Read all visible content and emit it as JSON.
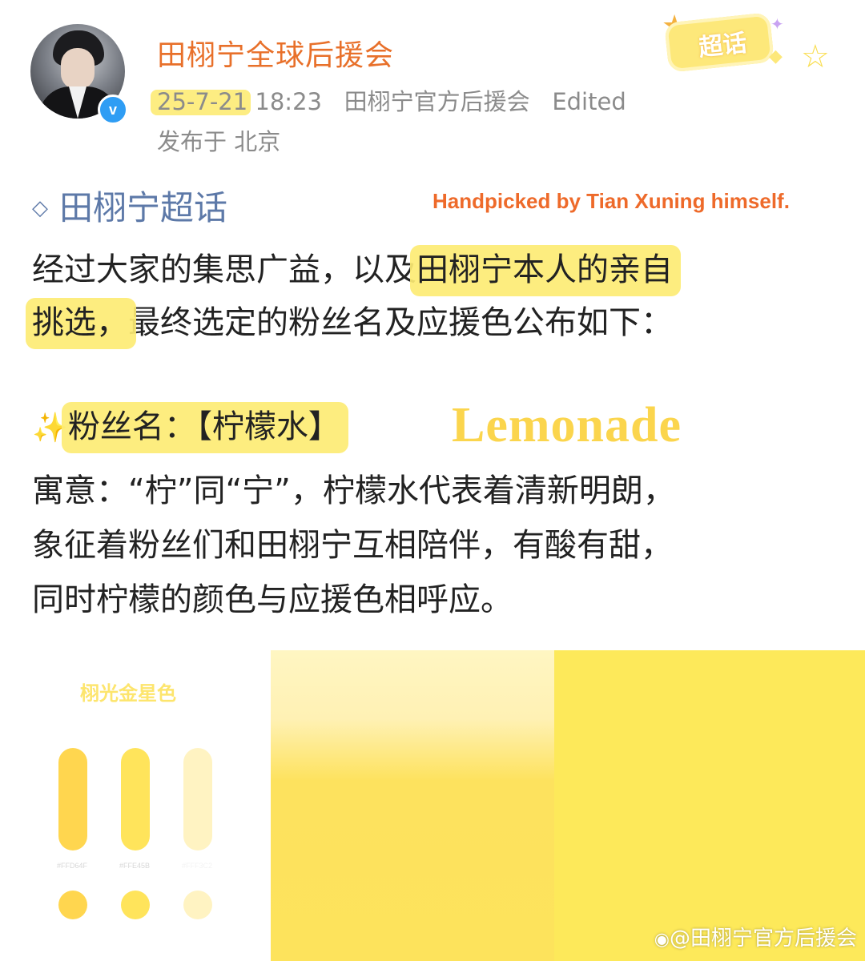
{
  "post": {
    "author": "田栩宁全球后援会",
    "date": "25-7-21",
    "time": "18:23",
    "source": "田栩宁官方后援会",
    "edited": "Edited",
    "location": "发布于 北京",
    "badge": "超话",
    "verified_glyph": "v",
    "topic": "田栩宁超话",
    "annotation": "Handpicked by Tian Xuning himself.",
    "para1": {
      "line1_before": "经过大家的集思广益，以及",
      "line1_highlight": "田栩宁本人的亲自",
      "line2_highlight": "挑选，",
      "line2_after": "最终选定的粉丝名及应援色公布如下："
    },
    "fan_name": {
      "sparkles": "✨",
      "label": "粉丝名：【柠檬水】",
      "english": "Lemonade"
    },
    "meaning_lines": [
      "寓意：“柠”同“宁”，柠檬水代表着清新明朗，",
      "象征着粉丝们和田栩宁互相陪伴，有酸有甜，",
      "同时柠檬的颜色与应援色相呼应。"
    ]
  },
  "palette": {
    "title": "栩光金星色",
    "swatches": [
      {
        "code": "#FFD64F",
        "color": "#FFD64F"
      },
      {
        "code": "#FFE45B",
        "color": "#FFE45B"
      },
      {
        "code": "#FFF3C2",
        "color": "#FFF3C2"
      }
    ]
  },
  "watermark": "@田栩宁官方后援会",
  "icons": {
    "verified": "verified-badge-icon",
    "topic": "diamond-topic-icon",
    "chaohua": "chaohua-badge-icon",
    "weibo": "weibo-logo-icon"
  }
}
